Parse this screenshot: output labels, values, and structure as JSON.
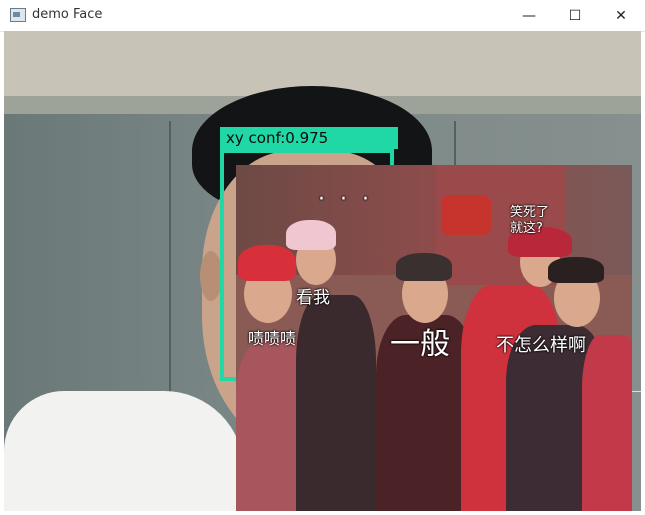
{
  "window": {
    "title": "demo Face",
    "controls": {
      "minimize": "—",
      "maximize": "☐",
      "close": "✕"
    }
  },
  "detection": {
    "label": "xy  conf:0.975",
    "box_color": "#1fd8a6"
  },
  "meme": {
    "text_dots": "· · ·",
    "text_laugh": "笑死了\n就这?",
    "text_look": "看我",
    "text_tsk": "啧啧啧",
    "text_average": "一般",
    "text_not_great": "不怎么样啊"
  },
  "icons": {
    "app": "app-window-icon",
    "minimize": "minimize-icon",
    "maximize": "maximize-icon",
    "close": "close-icon"
  }
}
